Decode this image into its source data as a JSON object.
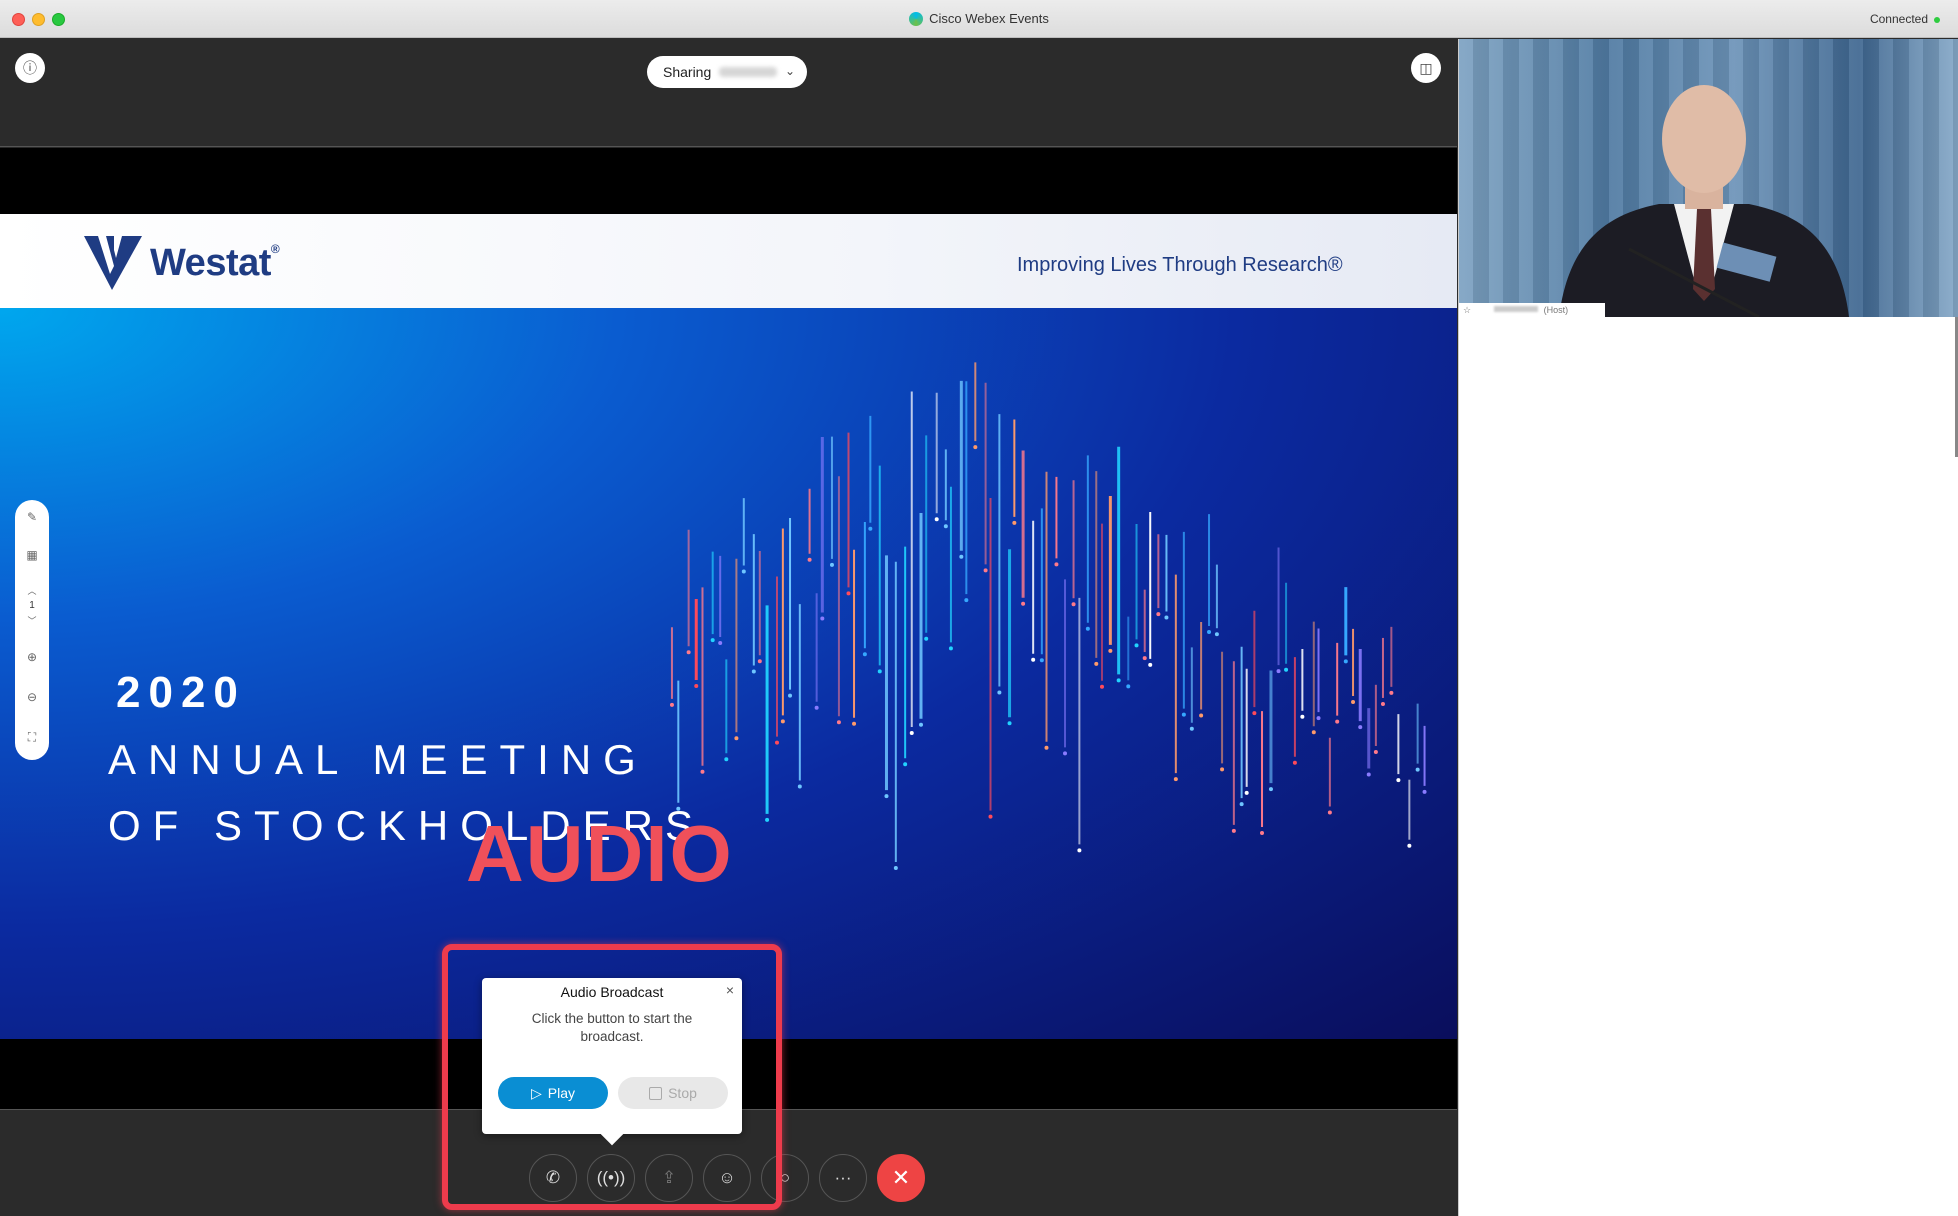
{
  "window": {
    "title": "Cisco Webex Events",
    "connection_status": "Connected",
    "status_color": "#2ecc40"
  },
  "top_bar": {
    "sharing_label": "Sharing",
    "info_icon": "info-icon",
    "layout_icon": "layout-icon"
  },
  "slide": {
    "logo_text": "Westat",
    "logo_mark": "®",
    "tagline": "Improving Lives Through Research®",
    "year": "2020",
    "line1": "ANNUAL MEETING",
    "line2": "OF STOCKHOLDERS",
    "overlay_word": "AUDIO"
  },
  "side_tools": {
    "page_number": "1",
    "icons": [
      "annotate-icon",
      "grid-icon",
      "zoom-in-icon",
      "zoom-out-icon",
      "fit-icon"
    ]
  },
  "popup": {
    "title": "Audio Broadcast",
    "message": "Click the button to start the broadcast.",
    "play_label": "Play",
    "stop_label": "Stop",
    "close_glyph": "×"
  },
  "controls": {
    "icons": [
      "phone-icon",
      "broadcast-icon",
      "share-icon",
      "participants-icon",
      "chat-icon",
      "more-icon",
      "end-icon"
    ],
    "more_glyph": "···",
    "end_glyph": "✕",
    "end_color": "#ee4444"
  },
  "video": {
    "host_tag": "(Host)"
  },
  "colors": {
    "highlight": "#ee3b4c",
    "play_button": "#0a8ed3",
    "brand_navy": "#1f3c83",
    "audio_text": "#f0505a"
  }
}
